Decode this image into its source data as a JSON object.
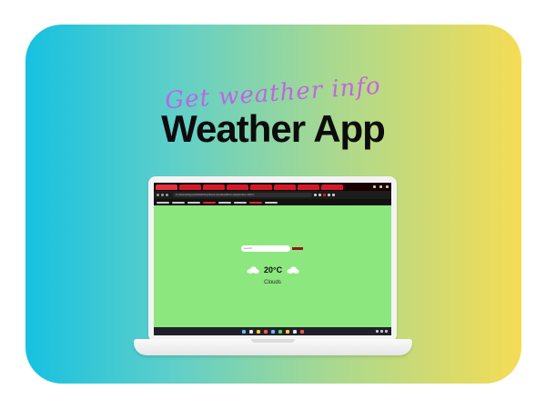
{
  "banner": {
    "script_title": "Get weather info",
    "main_title": "Weather App"
  },
  "browser": {
    "tab_count": 8,
    "url": "C:/Users/Ayush/Desktop/Sources/weather-app/index.html"
  },
  "weather_app": {
    "search_placeholder": "search",
    "temperature": "20°C",
    "condition": "Clouds"
  },
  "colors": {
    "card_gradient_start": "#16c1e0",
    "card_gradient_end": "#f5dc55",
    "app_background": "#8ce77f",
    "script_title": "#c35be8",
    "search_button": "#9a1414"
  }
}
